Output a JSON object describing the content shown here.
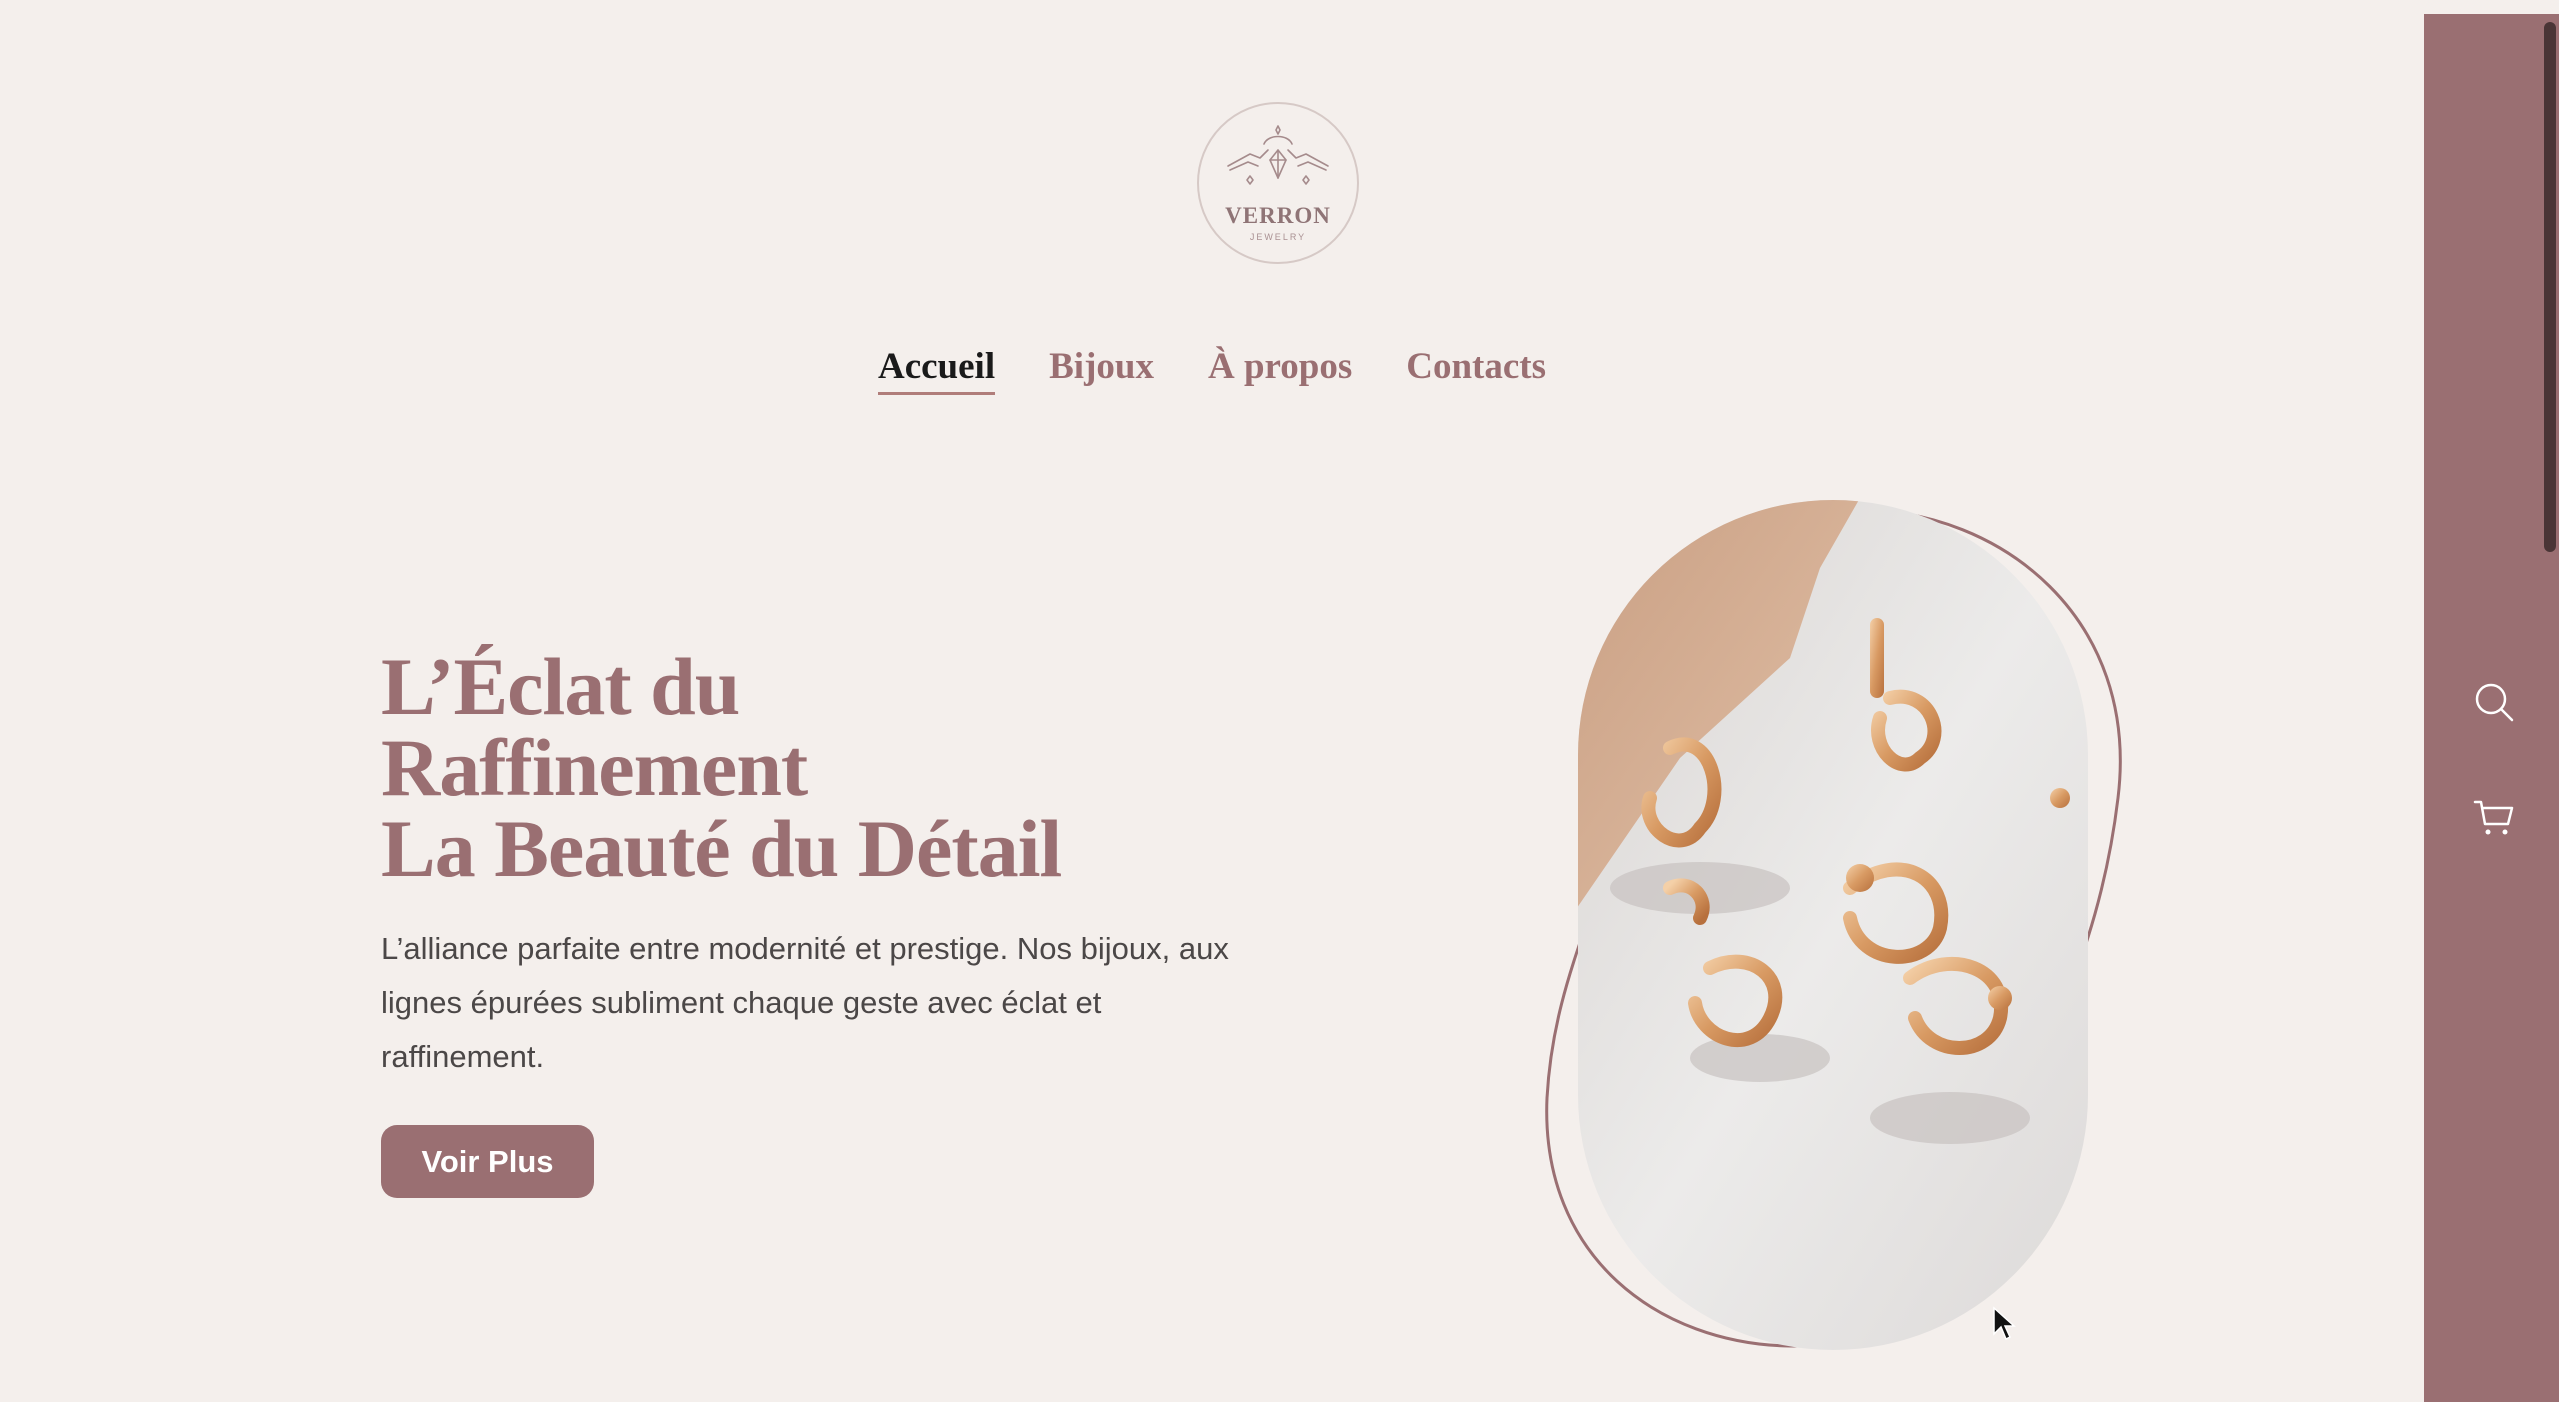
{
  "brand": {
    "name": "VERRON",
    "tagline": "JEWELRY"
  },
  "nav": {
    "items": [
      {
        "label": "Accueil",
        "active": true
      },
      {
        "label": "Bijoux",
        "active": false
      },
      {
        "label": "À propos",
        "active": false
      },
      {
        "label": "Contacts",
        "active": false
      }
    ]
  },
  "hero": {
    "headline": [
      "L’Éclat du",
      "Raffinement",
      "La Beauté du Détail"
    ],
    "description": "L’alliance parfaite entre modernité et prestige. Nos bijoux, aux lignes épurées subliment chaque geste avec éclat et raffinement.",
    "cta_label": "Voir Plus",
    "image": "rings-photo"
  },
  "sidebar": {
    "icons": [
      "search-icon",
      "cart-icon"
    ]
  },
  "colors": {
    "background": "#f4efec",
    "accent": "#9a6f72",
    "text": "#4b4747",
    "active_nav": "#1a1a1a"
  }
}
